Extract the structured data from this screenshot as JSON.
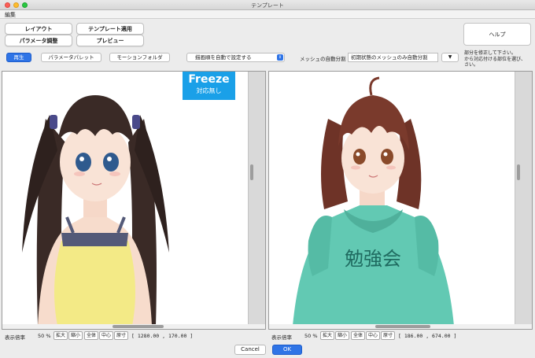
{
  "window": {
    "title": "テンプレート"
  },
  "menu": {
    "edit": "編集"
  },
  "top_buttons": {
    "layout": "レイアウト",
    "param_adjust": "パラメータ調整",
    "template_apply": "テンプレート適用",
    "preview": "プレビュー",
    "help": "ヘルプ"
  },
  "toolbar": {
    "play": "再生",
    "param_palette": "パラメータパレット",
    "motion_folder": "モーションフォルダ",
    "draw_order_select": "描画順を自動で設定する",
    "mesh_label": "メッシュの自動分割",
    "mesh_value": "初期状態のメッシュのみ自動分割",
    "hint_line1": "部分を修正して下さい。",
    "hint_line2": "から対応付ける部位を選び、",
    "hint_line3": "さい。"
  },
  "left_panel": {
    "badge_title": "Freeze",
    "badge_subtitle": "対応無し"
  },
  "status_left": {
    "zoom_label": "表示倍率",
    "zoom_value": "50 %",
    "zoom_in": "拡大",
    "zoom_out": "縮小",
    "fit_all": "全体",
    "center": "中心",
    "actual_size": "原寸",
    "coords": "[ 1280.00 ,  170.00 ]"
  },
  "status_right": {
    "zoom_label": "表示倍率",
    "zoom_value": "50 %",
    "zoom_in": "拡大",
    "zoom_out": "縮小",
    "fit_all": "全体",
    "center": "中心",
    "actual_size": "原寸",
    "coords": "[ 186.00 ,  674.00 ]"
  },
  "dialog": {
    "cancel": "Cancel",
    "ok": "OK"
  },
  "colors": {
    "accent": "#2f74e6",
    "badge": "#1aa0e8",
    "hoodie": "#62c9b3"
  },
  "shirt_text": "勉強会"
}
